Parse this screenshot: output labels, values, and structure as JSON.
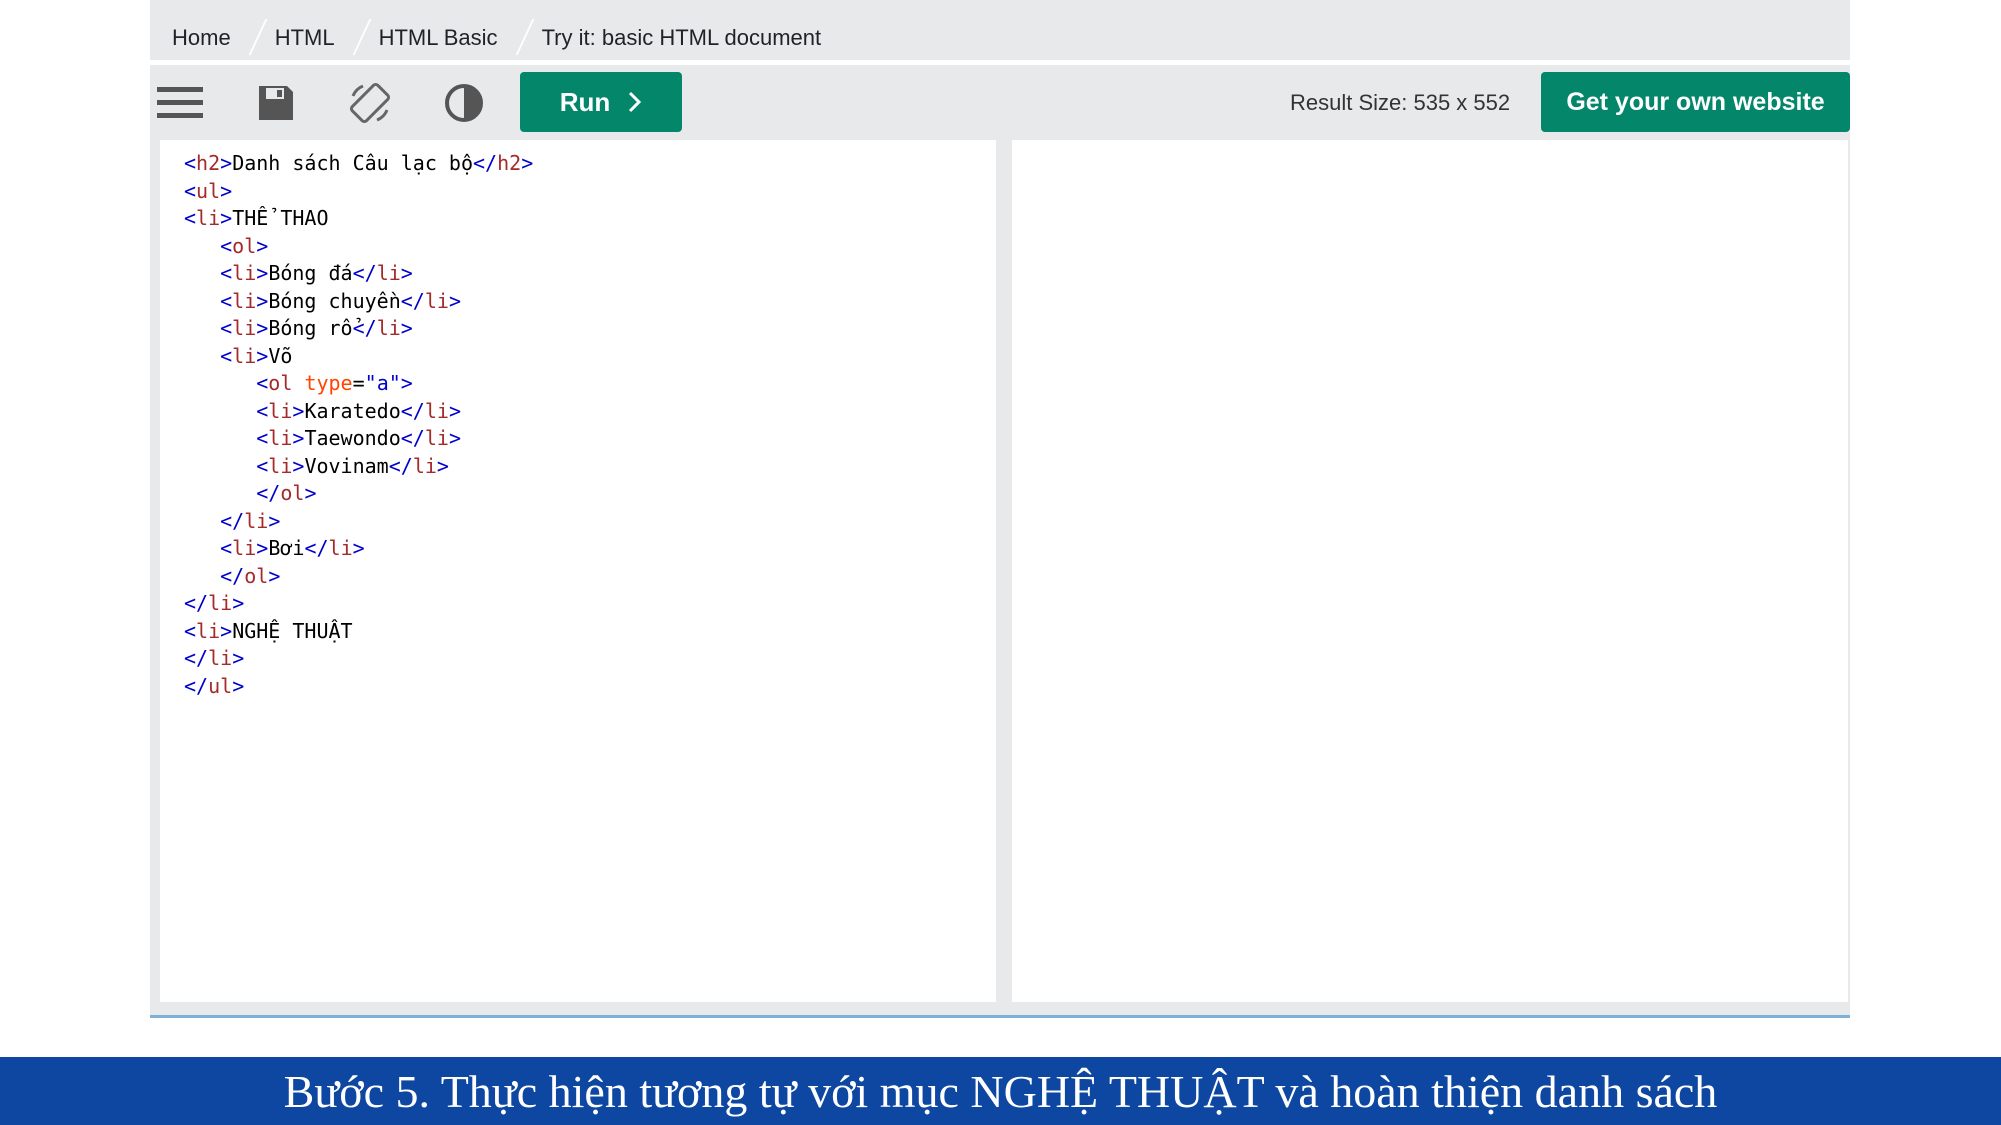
{
  "breadcrumb": {
    "items": [
      "Home",
      "HTML",
      "HTML Basic",
      "Try it: basic HTML document"
    ]
  },
  "toolbar": {
    "icons": [
      "menu-icon",
      "save-icon",
      "rotate-icon",
      "contrast-icon"
    ],
    "run_label": "Run",
    "result_size": "Result Size: 535 x 552",
    "get_website_label": "Get your own website"
  },
  "editor": {
    "lines": [
      "<h2>Danh sách Câu lạc bộ</h2>",
      "<ul>",
      "<li>THỂ THAO",
      "   <ol>",
      "   <li>Bóng đá</li>",
      "   <li>Bóng chuyền</li>",
      "   <li>Bóng rổ</li>",
      "   <li>Võ",
      "      <ol type=\"a\">",
      "      <li>Karatedo</li>",
      "      <li>Taewondo</li>",
      "      <li>Vovinam</li>",
      "      </ol>",
      "   </li>",
      "   <li>Bơi</li>",
      "   </ol>",
      "</li>",
      "<li>NGHỆ THUẬT",
      "</li>",
      "</ul>"
    ]
  },
  "caption": {
    "text": "Bước 5. Thực hiện tương tự với mục NGHỆ THUẬT và hoàn thiện danh sách"
  },
  "colors": {
    "accent_green": "#04866a",
    "toolbar_gray": "#e7e9eb",
    "caption_blue": "#0d47a1"
  }
}
